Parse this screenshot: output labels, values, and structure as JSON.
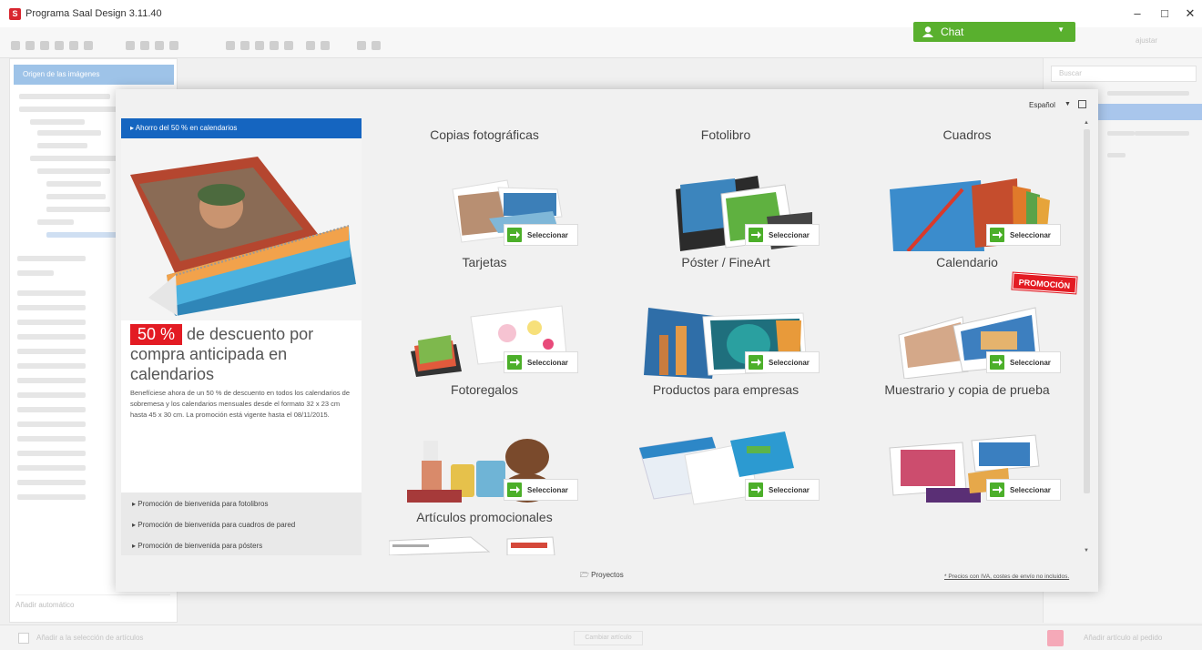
{
  "window": {
    "title": "Programa Saal Design 3.11.40",
    "icon_letter": "S",
    "controls": [
      "–",
      "□",
      "✕"
    ]
  },
  "toolbar": {
    "chat_label": "Chat",
    "zoom_value": "ajustar"
  },
  "left_panel": {
    "header": "Origen de las imágenes",
    "bottom_label": "Añadir automático"
  },
  "right_panel": {
    "search_placeholder": "Buscar"
  },
  "statusbar": {
    "left_text": "Añadir a la selección de artículos",
    "mid_text": "Cambiar artículo",
    "right_text": "Añadir artículo al pedido"
  },
  "modal": {
    "language": "Español",
    "promo": {
      "header": "Ahorro del 50 % en calendarios",
      "percent": "50 %",
      "title": "de descuento por compra anticipada en calendarios",
      "body": "Benefíciese ahora de un 50 % de descuento en todos los calendarios de sobremesa y los calendarios mensuales desde el formato 32 x 23 cm hasta 45 x 30 cm. La promoción está vigente hasta el 08/11/2015.",
      "links": [
        "Promoción de bienvenida para fotolibros",
        "Promoción de bienvenida para cuadros de pared",
        "Promoción de bienvenida para pósters"
      ]
    },
    "select_label": "Seleccionar",
    "promo_ribbon": "PROMOCIÓN",
    "products": [
      {
        "title": "Copias fotográficas"
      },
      {
        "title": "Fotolibro"
      },
      {
        "title": "Cuadros"
      },
      {
        "title": "Tarjetas"
      },
      {
        "title": "Póster / FineArt"
      },
      {
        "title": "Calendario"
      },
      {
        "title": "Fotoregalos"
      },
      {
        "title": "Productos para empresas"
      },
      {
        "title": "Muestrario y copia de prueba"
      },
      {
        "title": "Artículos promocionales"
      }
    ],
    "projects_label": "Proyectos",
    "footnote": "* Precios con IVA, costes de envío no incluidos."
  },
  "colors": {
    "chat_green": "#59b02e",
    "promo_blue": "#1565c0",
    "discount_red": "#e31b23",
    "select_arrow_green": "#4caf2a"
  }
}
